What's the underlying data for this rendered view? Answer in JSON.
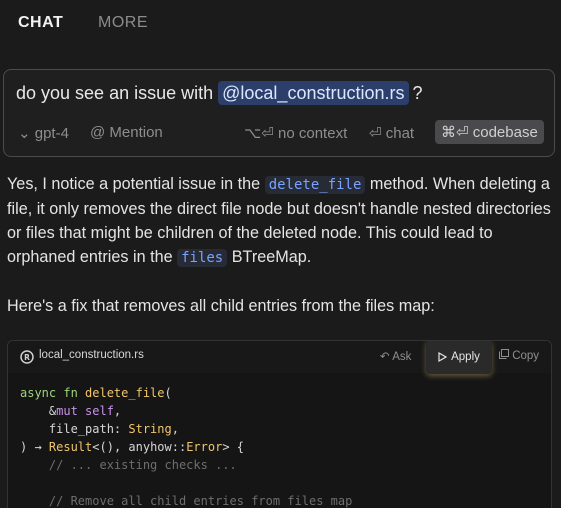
{
  "tabs": {
    "chat": "CHAT",
    "more": "MORE"
  },
  "composer": {
    "prompt_prefix": "do you see an issue with",
    "mention": "@local_construction.rs",
    "prompt_suffix": "?",
    "model": "⌄ gpt-4",
    "mention_btn": "@ Mention",
    "no_context": "⌥⏎ no context",
    "chat": "⏎ chat",
    "codebase": "⌘⏎ codebase"
  },
  "answer": {
    "p1_a": "Yes, I notice a potential issue in the",
    "p1_code1": "delete_file",
    "p1_b": "method. When deleting a file, it only removes the direct file node but doesn't handle nested directories or files that might be children of the deleted node. This could lead to orphaned entries in the",
    "p1_code2": "files",
    "p1_c": "BTreeMap.",
    "p2": "Here's a fix that removes all child entries from the files map:"
  },
  "codeblock": {
    "filename": "local_construction.rs",
    "ask": "↶ Ask",
    "apply": "Apply",
    "copy": "Copy",
    "lines": {
      "l1_kw": "async fn ",
      "l1_fn": "delete_file",
      "l1_rest": "(",
      "l2_amp": "    &",
      "l2_kw": "mut self",
      "l2_rest": ",",
      "l3_a": "    file_path: ",
      "l3_ty": "String",
      "l3_b": ",",
      "l4_a": ") → ",
      "l4_ty": "Result",
      "l4_b": "<(), anyhow::",
      "l4_ty2": "Error",
      "l4_c": "> {",
      "l5": "    // ... existing checks ...",
      "l6": "",
      "l7": "    // Remove all child entries from files map"
    }
  }
}
